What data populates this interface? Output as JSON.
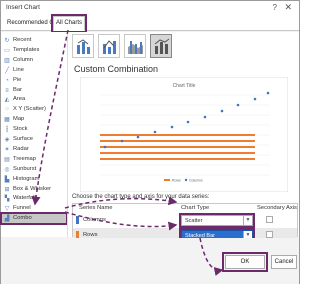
{
  "dialog": {
    "title": "Insert Chart",
    "help": "?",
    "close": "✕"
  },
  "tabs": {
    "recommended": "Recommended Charts",
    "all": "All Charts"
  },
  "categories": [
    {
      "label": "Recent",
      "icon": "recent-icon"
    },
    {
      "label": "Templates",
      "icon": "templates-icon"
    },
    {
      "label": "Column",
      "icon": "column-icon"
    },
    {
      "label": "Line",
      "icon": "line-icon"
    },
    {
      "label": "Pie",
      "icon": "pie-icon"
    },
    {
      "label": "Bar",
      "icon": "bar-icon"
    },
    {
      "label": "Area",
      "icon": "area-icon"
    },
    {
      "label": "X Y (Scatter)",
      "icon": "scatter-icon"
    },
    {
      "label": "Map",
      "icon": "map-icon"
    },
    {
      "label": "Stock",
      "icon": "stock-icon"
    },
    {
      "label": "Surface",
      "icon": "surface-icon"
    },
    {
      "label": "Radar",
      "icon": "radar-icon"
    },
    {
      "label": "Treemap",
      "icon": "treemap-icon"
    },
    {
      "label": "Sunburst",
      "icon": "sunburst-icon"
    },
    {
      "label": "Histogram",
      "icon": "histogram-icon"
    },
    {
      "label": "Box & Whisker",
      "icon": "box-whisker-icon"
    },
    {
      "label": "Waterfall",
      "icon": "waterfall-icon"
    },
    {
      "label": "Funnel",
      "icon": "funnel-icon"
    },
    {
      "label": "Combo",
      "icon": "combo-icon"
    }
  ],
  "main": {
    "heading": "Custom Combination",
    "preview_title": "Chart Title",
    "legend": [
      "Rows",
      "Columns"
    ],
    "instructions": "Choose the chart type and axis for your data series:",
    "table_headers": {
      "series_name": "Series Name",
      "chart_type": "Chart Type",
      "secondary_axis": "Secondary Axis"
    },
    "series": [
      {
        "name": "Columns",
        "color": "#4472c4",
        "chart_type": "Scatter",
        "secondary": false
      },
      {
        "name": "Rows",
        "color": "#ed7d31",
        "chart_type": "Stacked Bar",
        "secondary": false
      }
    ]
  },
  "footer": {
    "ok": "OK",
    "cancel": "Cancel"
  },
  "colors": {
    "highlight": "#6b2b6b",
    "selected_dropdown": "#2a6ecf"
  }
}
